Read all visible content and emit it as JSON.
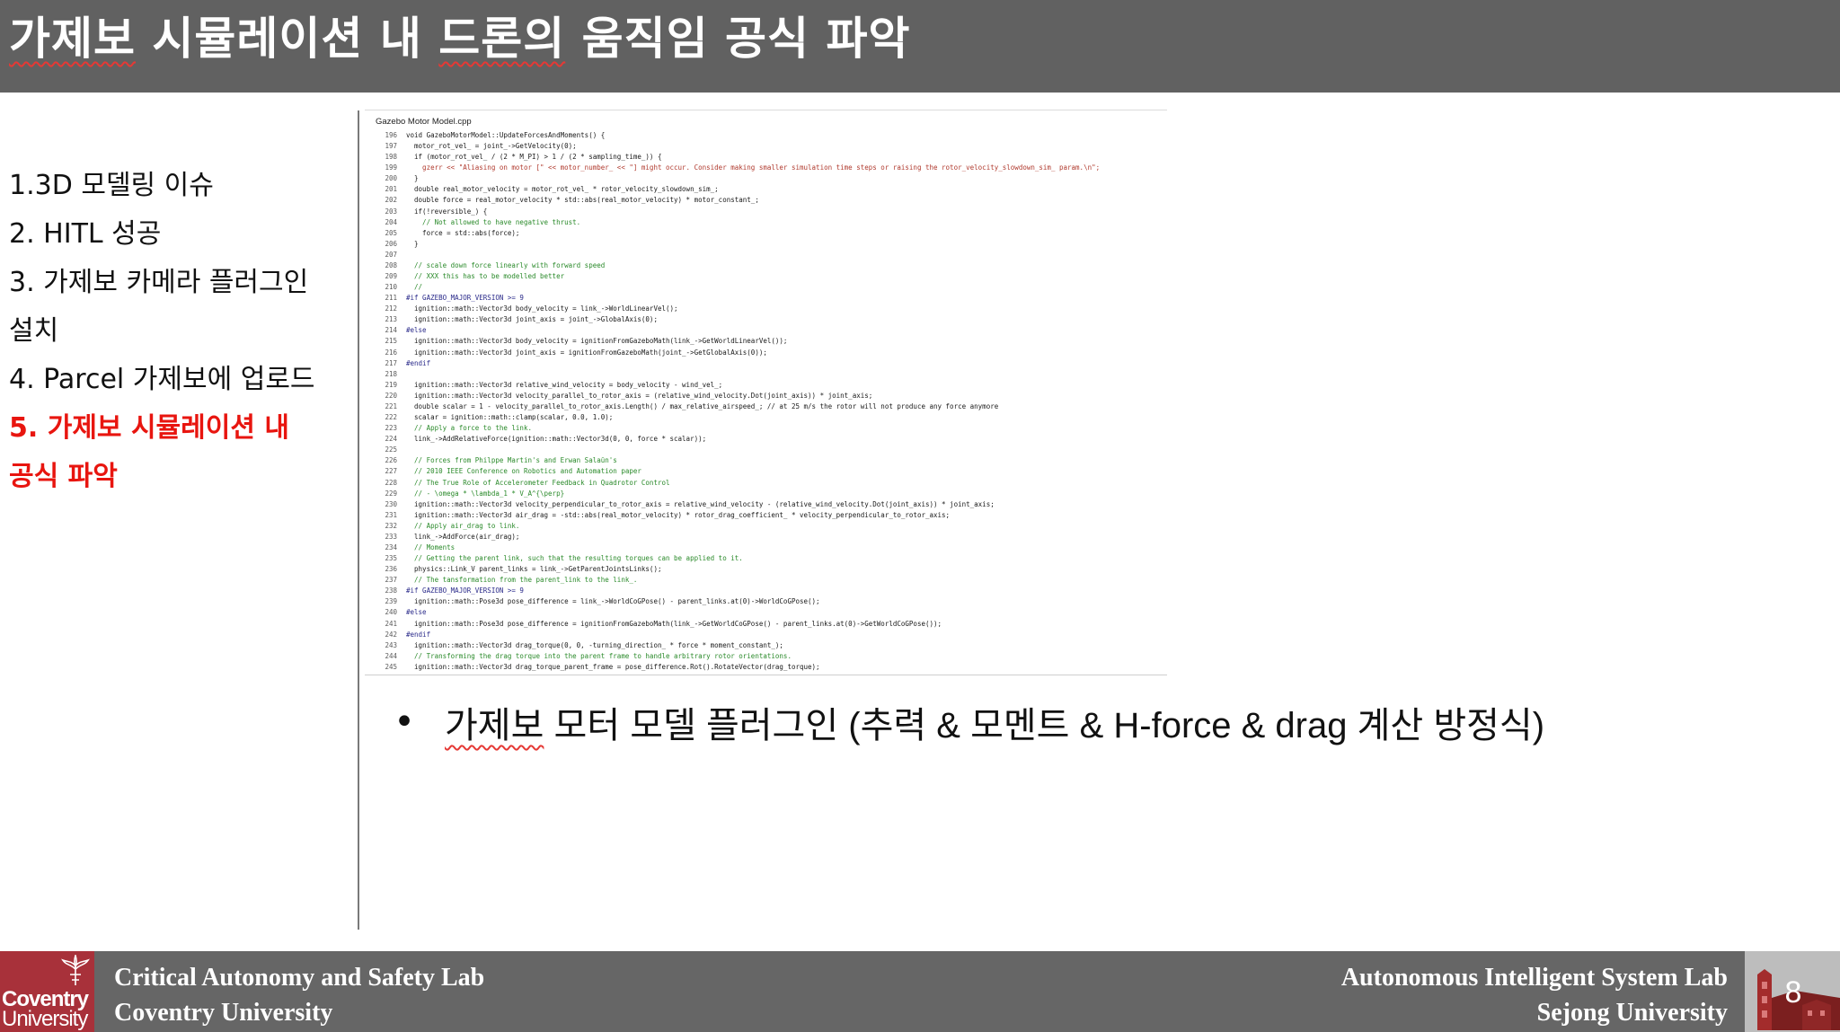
{
  "slide": {
    "title_parts": [
      {
        "text": "가제보",
        "squiggle": true
      },
      {
        "text": " 시뮬레이션 내 ",
        "squiggle": false
      },
      {
        "text": "드론의",
        "squiggle": true
      },
      {
        "text": " 움직임 공식 파악",
        "squiggle": false
      }
    ],
    "page_number": "8"
  },
  "toc": {
    "items": [
      {
        "text": "1.3D 모델링 이슈",
        "active": false
      },
      {
        "text": "2. HITL 성공",
        "active": false
      },
      {
        "text": "3. 가제보 카메라 플러그인",
        "active": false
      },
      {
        "text": "설치",
        "active": false
      },
      {
        "text": "4. Parcel 가제보에 업로드",
        "active": false
      },
      {
        "text": "5. 가제보 시뮬레이션 내",
        "active": true
      },
      {
        "text": "공식 파악",
        "active": true
      }
    ]
  },
  "code": {
    "filename": "Gazebo Motor Model.cpp",
    "lines": [
      {
        "n": "196",
        "t": "void GazeboMotorModel::UpdateForcesAndMoments() {",
        "k": ""
      },
      {
        "n": "197",
        "t": "  motor_rot_vel_ = joint_->GetVelocity(0);",
        "k": ""
      },
      {
        "n": "198",
        "t": "  if (motor_rot_vel_ / (2 * M_PI) > 1 / (2 * sampling_time_)) {",
        "k": ""
      },
      {
        "n": "199",
        "t": "    gzerr << \"Aliasing on motor [\" << motor_number_ << \"] might occur. Consider making smaller simulation time steps or raising the rotor_velocity_slowdown_sim_ param.\\n\";",
        "k": "string"
      },
      {
        "n": "200",
        "t": "  }",
        "k": ""
      },
      {
        "n": "201",
        "t": "  double real_motor_velocity = motor_rot_vel_ * rotor_velocity_slowdown_sim_;",
        "k": ""
      },
      {
        "n": "202",
        "t": "  double force = real_motor_velocity * std::abs(real_motor_velocity) * motor_constant_;",
        "k": ""
      },
      {
        "n": "203",
        "t": "  if(!reversible_) {",
        "k": ""
      },
      {
        "n": "204",
        "t": "    // Not allowed to have negative thrust.",
        "k": "comment"
      },
      {
        "n": "205",
        "t": "    force = std::abs(force);",
        "k": ""
      },
      {
        "n": "206",
        "t": "  }",
        "k": ""
      },
      {
        "n": "207",
        "t": "",
        "k": ""
      },
      {
        "n": "208",
        "t": "  // scale down force linearly with forward speed",
        "k": "comment"
      },
      {
        "n": "209",
        "t": "  // XXX this has to be modelled better",
        "k": "comment"
      },
      {
        "n": "210",
        "t": "  //",
        "k": "comment"
      },
      {
        "n": "211",
        "t": "#if GAZEBO_MAJOR_VERSION >= 9",
        "k": "directive"
      },
      {
        "n": "212",
        "t": "  ignition::math::Vector3d body_velocity = link_->WorldLinearVel();",
        "k": ""
      },
      {
        "n": "213",
        "t": "  ignition::math::Vector3d joint_axis = joint_->GlobalAxis(0);",
        "k": ""
      },
      {
        "n": "214",
        "t": "#else",
        "k": "directive"
      },
      {
        "n": "215",
        "t": "  ignition::math::Vector3d body_velocity = ignitionFromGazeboMath(link_->GetWorldLinearVel());",
        "k": ""
      },
      {
        "n": "216",
        "t": "  ignition::math::Vector3d joint_axis = ignitionFromGazeboMath(joint_->GetGlobalAxis(0));",
        "k": ""
      },
      {
        "n": "217",
        "t": "#endif",
        "k": "directive"
      },
      {
        "n": "218",
        "t": "",
        "k": ""
      },
      {
        "n": "219",
        "t": "  ignition::math::Vector3d relative_wind_velocity = body_velocity - wind_vel_;",
        "k": ""
      },
      {
        "n": "220",
        "t": "  ignition::math::Vector3d velocity_parallel_to_rotor_axis = (relative_wind_velocity.Dot(joint_axis)) * joint_axis;",
        "k": ""
      },
      {
        "n": "221",
        "t": "  double scalar = 1 - velocity_parallel_to_rotor_axis.Length() / max_relative_airspeed_; // at 25 m/s the rotor will not produce any force anymore",
        "k": ""
      },
      {
        "n": "222",
        "t": "  scalar = ignition::math::clamp(scalar, 0.0, 1.0);",
        "k": ""
      },
      {
        "n": "223",
        "t": "  // Apply a force to the link.",
        "k": "comment"
      },
      {
        "n": "224",
        "t": "  link_->AddRelativeForce(ignition::math::Vector3d(0, 0, force * scalar));",
        "k": ""
      },
      {
        "n": "225",
        "t": "",
        "k": ""
      },
      {
        "n": "226",
        "t": "  // Forces from Philppe Martin's and Erwan Salaün's",
        "k": "comment"
      },
      {
        "n": "227",
        "t": "  // 2010 IEEE Conference on Robotics and Automation paper",
        "k": "comment"
      },
      {
        "n": "228",
        "t": "  // The True Role of Accelerometer Feedback in Quadrotor Control",
        "k": "comment"
      },
      {
        "n": "229",
        "t": "  // - \\omega * \\lambda_1 * V_A^{\\perp}",
        "k": "comment"
      },
      {
        "n": "230",
        "t": "  ignition::math::Vector3d velocity_perpendicular_to_rotor_axis = relative_wind_velocity - (relative_wind_velocity.Dot(joint_axis)) * joint_axis;",
        "k": ""
      },
      {
        "n": "231",
        "t": "  ignition::math::Vector3d air_drag = -std::abs(real_motor_velocity) * rotor_drag_coefficient_ * velocity_perpendicular_to_rotor_axis;",
        "k": ""
      },
      {
        "n": "232",
        "t": "  // Apply air_drag to link.",
        "k": "comment"
      },
      {
        "n": "233",
        "t": "  link_->AddForce(air_drag);",
        "k": ""
      },
      {
        "n": "234",
        "t": "  // Moments",
        "k": "comment"
      },
      {
        "n": "235",
        "t": "  // Getting the parent link, such that the resulting torques can be applied to it.",
        "k": "comment"
      },
      {
        "n": "236",
        "t": "  physics::Link_V parent_links = link_->GetParentJointsLinks();",
        "k": ""
      },
      {
        "n": "237",
        "t": "  // The tansformation from the parent_link to the link_.",
        "k": "comment"
      },
      {
        "n": "238",
        "t": "#if GAZEBO_MAJOR_VERSION >= 9",
        "k": "directive"
      },
      {
        "n": "239",
        "t": "  ignition::math::Pose3d pose_difference = link_->WorldCoGPose() - parent_links.at(0)->WorldCoGPose();",
        "k": ""
      },
      {
        "n": "240",
        "t": "#else",
        "k": "directive"
      },
      {
        "n": "241",
        "t": "  ignition::math::Pose3d pose_difference = ignitionFromGazeboMath(link_->GetWorldCoGPose() - parent_links.at(0)->GetWorldCoGPose());",
        "k": ""
      },
      {
        "n": "242",
        "t": "#endif",
        "k": "directive"
      },
      {
        "n": "243",
        "t": "  ignition::math::Vector3d drag_torque(0, 0, -turning_direction_ * force * moment_constant_);",
        "k": ""
      },
      {
        "n": "244",
        "t": "  // Transforming the drag torque into the parent frame to handle arbitrary rotor orientations.",
        "k": "comment"
      },
      {
        "n": "245",
        "t": "  ignition::math::Vector3d drag_torque_parent_frame = pose_difference.Rot().RotateVector(drag_torque);",
        "k": ""
      }
    ]
  },
  "bullet": {
    "symbol": "•",
    "squiggle_word": "가제보",
    "rest_text": " 모터 모델 플러그인 (추력 & 모멘트 & H-force & drag 계산 방정식)"
  },
  "footer": {
    "left_line1": "Critical Autonomy and Safety Lab",
    "left_line2": "Coventry University",
    "right_line1": "Autonomous Intelligent System Lab",
    "right_line2": "Sejong University",
    "coventry_logo_line1": "Coventry",
    "coventry_logo_line2": "University",
    "coventry_crest_icon": "phoenix-crest-icon",
    "sejong_logo_icon": "building-icon"
  },
  "colors": {
    "title_bar": "#616161",
    "footer_bar": "#666666",
    "active_item": "#e8150f",
    "coventry_red": "#a8313a"
  }
}
